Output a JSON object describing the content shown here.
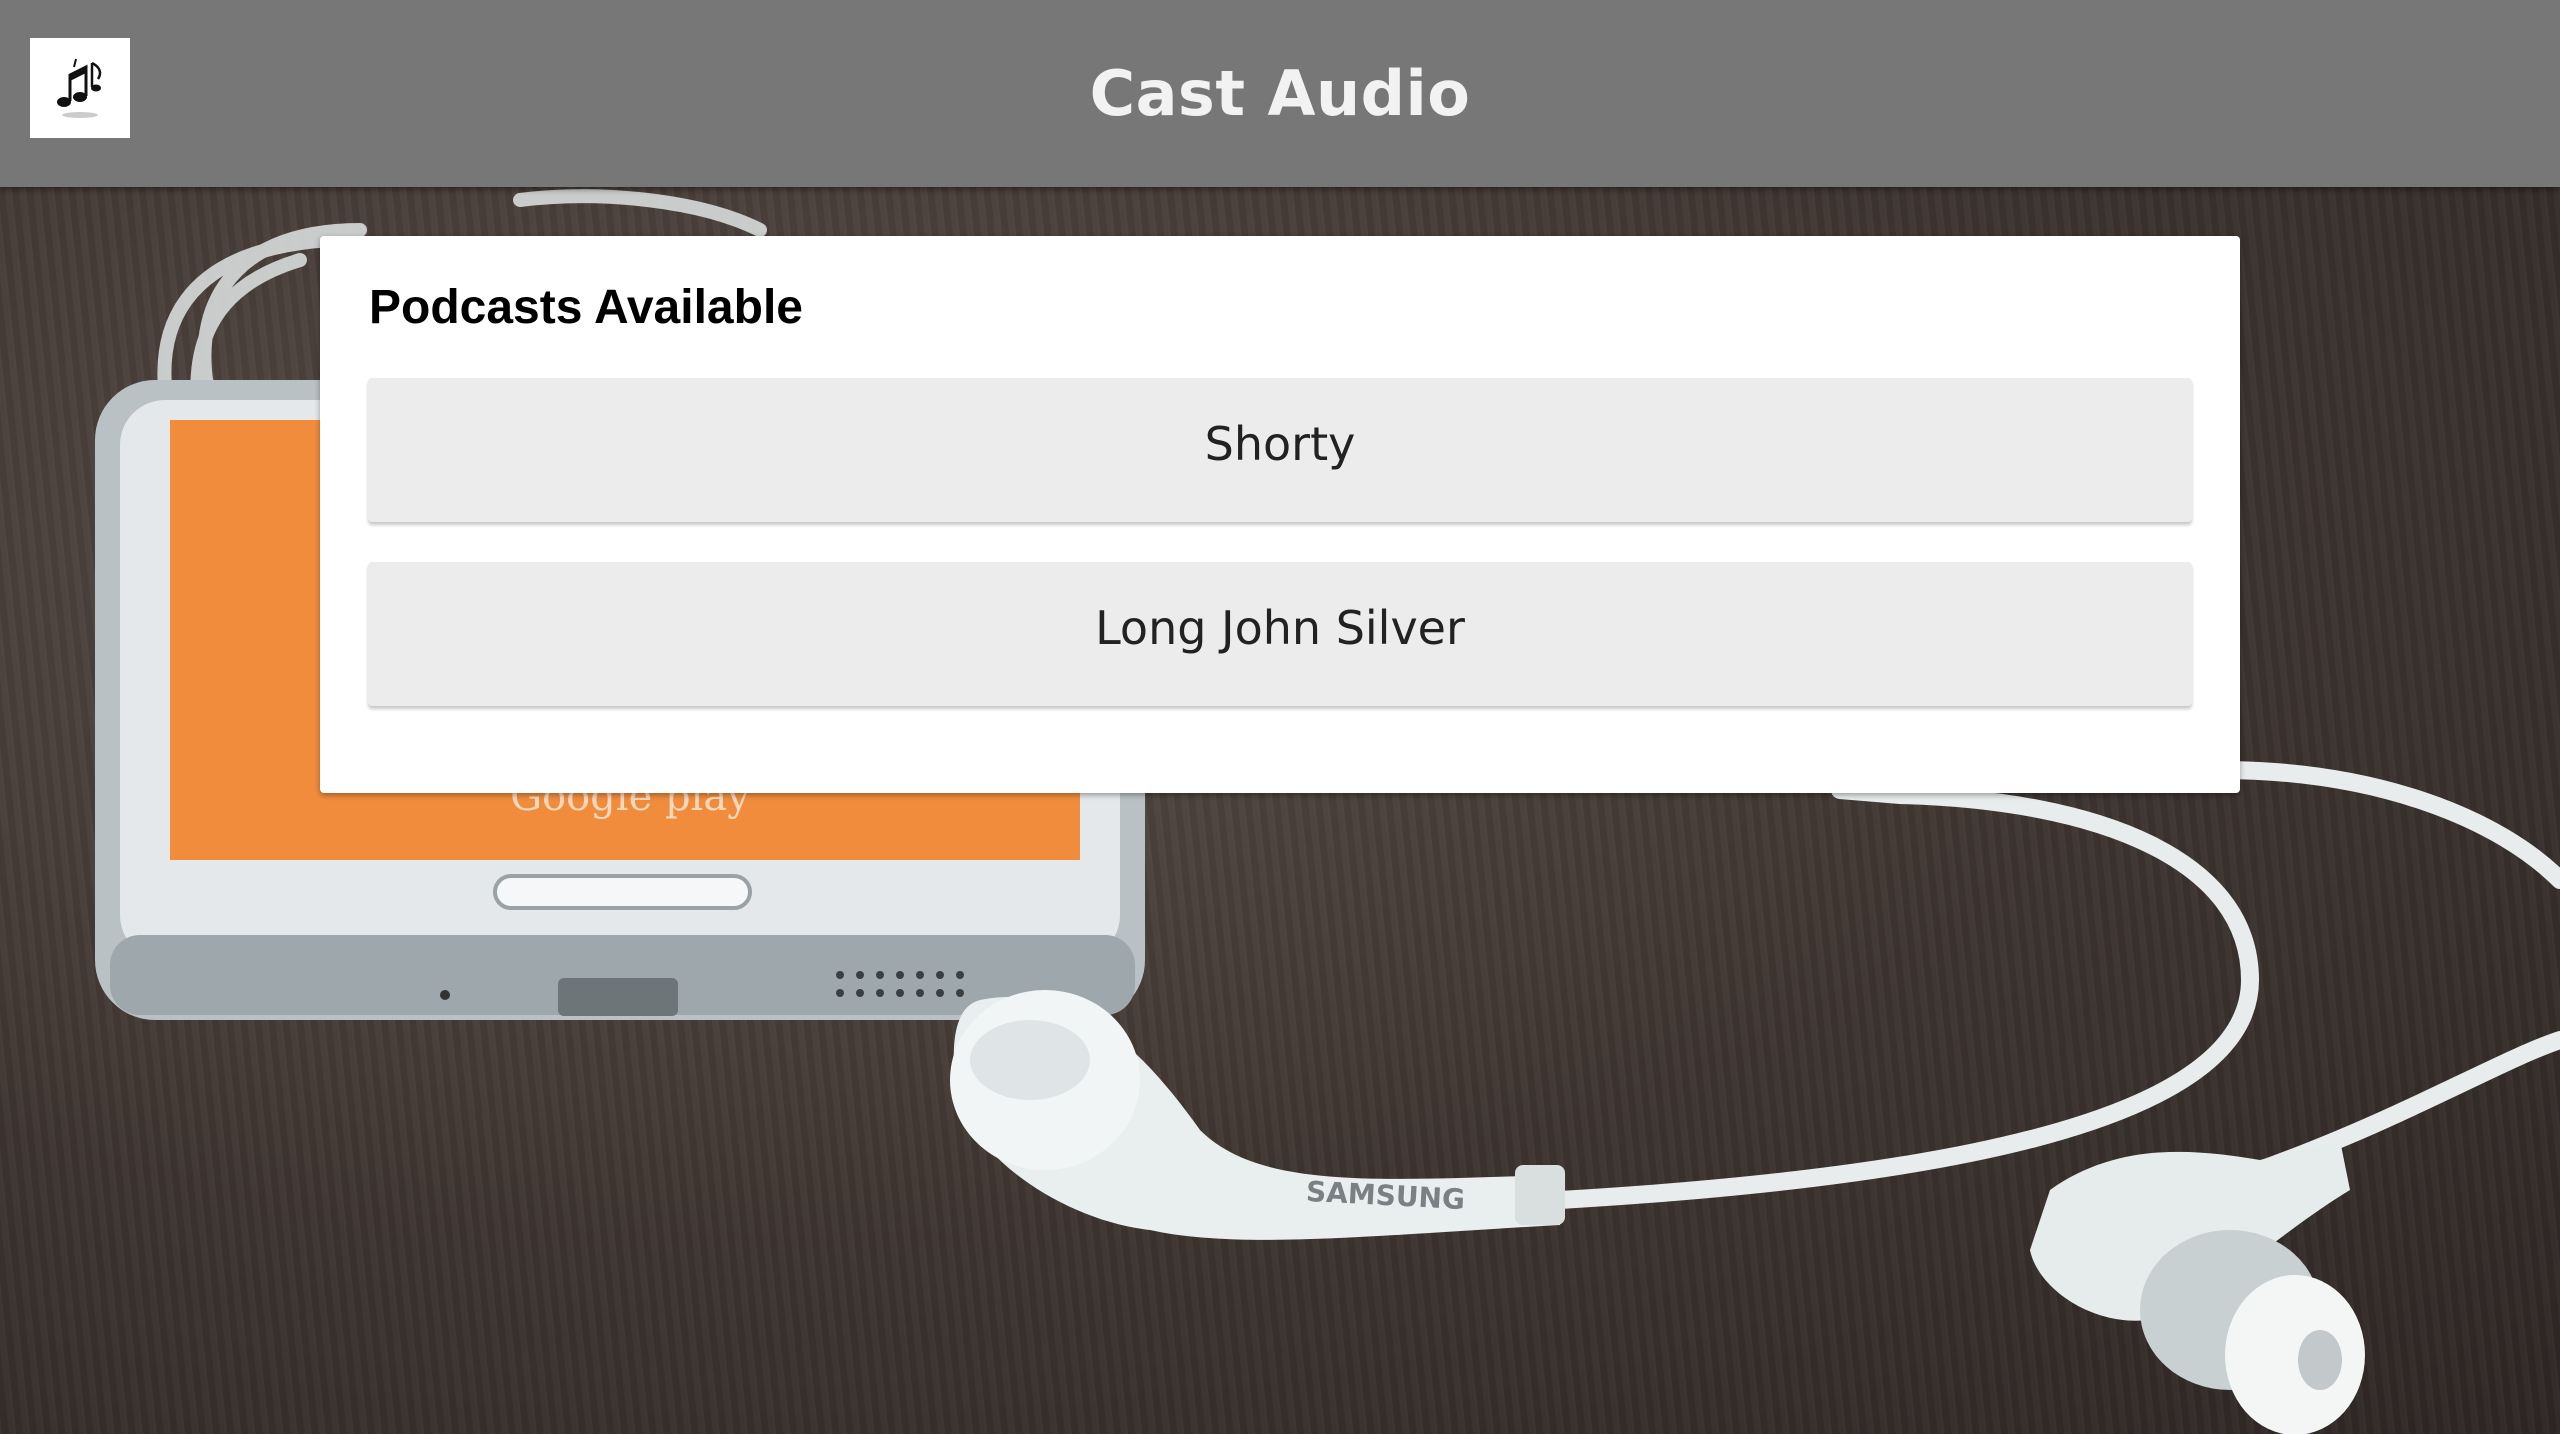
{
  "header": {
    "title": "Cast Audio",
    "logo_icon": "music-notes-icon"
  },
  "podcasts": {
    "heading": "Podcasts Available",
    "items": [
      {
        "label": "Shorty"
      },
      {
        "label": "Long John Silver"
      }
    ]
  },
  "background": {
    "phone_screen_text": "Google play",
    "earphone_brand": "SAMSUNG"
  },
  "colors": {
    "header_bg": "#777777",
    "header_text": "#f2f2f2",
    "item_bg": "#ececec",
    "phone_screen": "#f08c3c",
    "table_wood": "#3e3531"
  }
}
